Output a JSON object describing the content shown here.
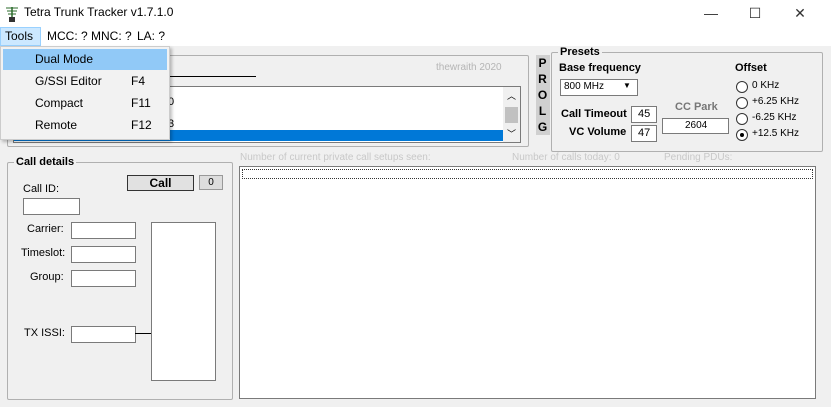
{
  "window": {
    "title": "Tetra Trunk Tracker v1.7.1.0",
    "minimize_glyph": "—",
    "maximize_glyph": "☐",
    "close_glyph": "✕"
  },
  "menu": {
    "tools": "Tools",
    "mcc": "MCC: ?",
    "mnc": "MNC: ?",
    "la": "LA: ?"
  },
  "tools_menu": {
    "items": [
      {
        "label": "Dual Mode",
        "shortcut": ""
      },
      {
        "label": "G/SSI Editor",
        "shortcut": "F4"
      },
      {
        "label": "Compact",
        "shortcut": "F11"
      },
      {
        "label": "Remote",
        "shortcut": "F12"
      }
    ]
  },
  "top_panel": {
    "credit": "thewraith 2020",
    "list_fragments": [
      "0",
      "3"
    ]
  },
  "prolg_buttons": [
    "P",
    "R",
    "O",
    "L",
    "G"
  ],
  "presets": {
    "title": "Presets",
    "base_frequency_label": "Base frequency",
    "base_frequency_value": "800 MHz",
    "call_timeout_label": "Call Timeout",
    "call_timeout_value": "45",
    "vc_volume_label": "VC Volume",
    "vc_volume_value": "47",
    "cc_park_label": "CC Park",
    "cc_park_value": "2604",
    "offset_title": "Offset",
    "offsets": [
      "0 KHz",
      "+6.25 KHz",
      "-6.25 KHz",
      "+12.5 KHz"
    ],
    "offset_selected": "+12.5 KHz"
  },
  "call_details": {
    "title": "Call details",
    "call_button": "Call",
    "counter": "0",
    "call_id_label": "Call ID:",
    "carrier_label": "Carrier:",
    "timeslot_label": "Timeslot:",
    "group_label": "Group:",
    "tx_issi_label": "TX ISSI:"
  },
  "status_line": {
    "private_setups": "Number of current private call setups seen:",
    "calls_today": "Number of calls today: 0",
    "pending_pdus": "Pending PDUs:"
  }
}
